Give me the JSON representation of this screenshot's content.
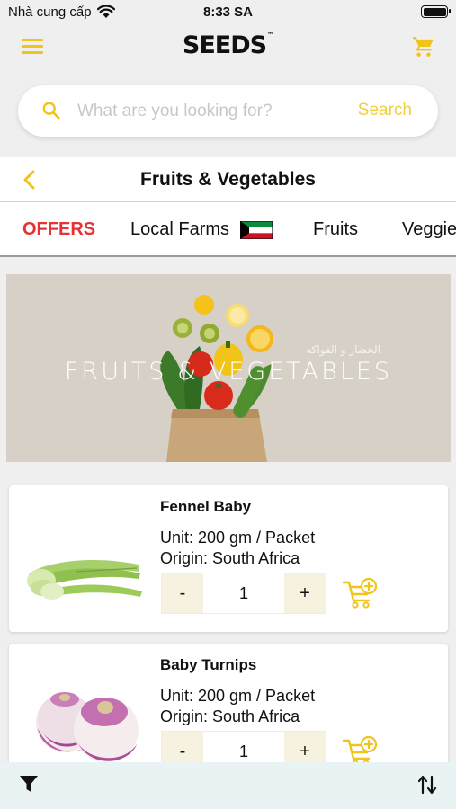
{
  "status_bar": {
    "carrier": "Nhà cung cấp",
    "time": "8:33 SA"
  },
  "header": {
    "logo": "SEEDS",
    "logo_mark": "™"
  },
  "search": {
    "placeholder": "What are you looking for?",
    "button_label": "Search"
  },
  "page": {
    "title": "Fruits & Vegetables"
  },
  "tabs": [
    {
      "label": "OFFERS",
      "active": true
    },
    {
      "label": "Local Farms",
      "flag": "kuwait-flag"
    },
    {
      "label": "Fruits"
    },
    {
      "label": "Veggies"
    }
  ],
  "banner": {
    "text": "FRUITS & VEGETABLES",
    "arabic": "الخضار و الفواكه"
  },
  "products": [
    {
      "name": "Fennel Baby",
      "unit": "Unit:  200 gm / Packet",
      "origin": "Origin: South Africa",
      "minus": "-",
      "quantity": "1",
      "plus": "+"
    },
    {
      "name": "Baby Turnips",
      "unit": "Unit:  200 gm / Packet",
      "origin": "Origin: South Africa",
      "minus": "-",
      "quantity": "1",
      "plus": "+"
    }
  ],
  "colors": {
    "accent": "#f0c419",
    "offers": "#e63232",
    "background": "#efefef"
  },
  "icons": {
    "menu": "menu-icon",
    "cart": "cart-icon",
    "search": "search-icon",
    "back": "back-chevron-icon",
    "add_to_cart": "add-to-cart-icon",
    "filter": "filter-icon",
    "sort": "sort-icon"
  }
}
